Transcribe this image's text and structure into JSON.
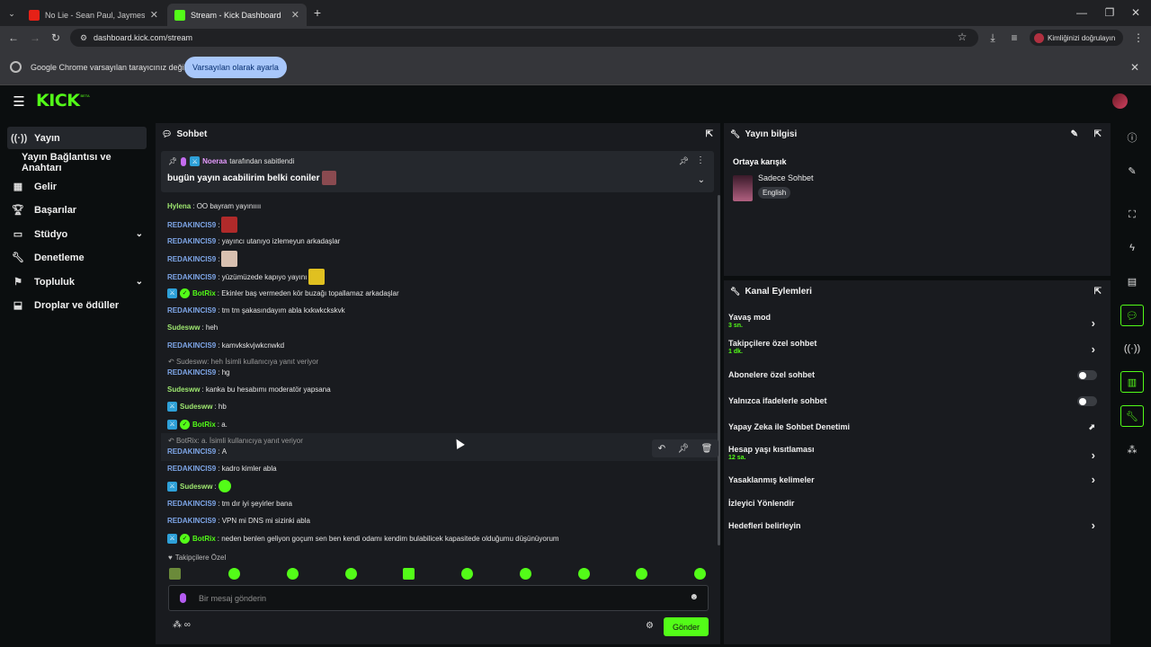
{
  "browser": {
    "tabs": [
      {
        "title": "No Lie - Sean Paul, Jaymes You",
        "active": false
      },
      {
        "title": "Stream - Kick Dashboard",
        "active": true
      }
    ],
    "new_tab_icon": "+",
    "url": "dashboard.kick.com/stream",
    "profile_label": "Kimliğinizi doğrulayın",
    "infobar_text": "Google Chrome varsayılan tarayıcınız değil",
    "infobar_button": "Varsayılan olarak ayarla"
  },
  "app": {
    "logo": "KICK",
    "logo_sup": "BETA"
  },
  "sidebar": {
    "items": [
      {
        "label": "Yayın",
        "icon": "stream-icon"
      },
      {
        "label": "Yayın Bağlantısı ve Anahtarı",
        "icon": ""
      },
      {
        "label": "Gelir",
        "icon": "chart-icon"
      },
      {
        "label": "Başarılar",
        "icon": "trophy-icon"
      },
      {
        "label": "Stüdyo",
        "icon": "studio-icon"
      },
      {
        "label": "Denetleme",
        "icon": "wrench-icon"
      },
      {
        "label": "Topluluk",
        "icon": "community-icon"
      },
      {
        "label": "Droplar ve ödüller",
        "icon": "drops-icon"
      }
    ]
  },
  "chat": {
    "title": "Sohbet",
    "pinned_by_user": "Noeraa",
    "pinned_by_text": "tarafından sabitlendi",
    "pinned_message": "bugün yayın acabilirim belki coniler",
    "messages": [
      {
        "user": "Hylena",
        "text": "OO bayram yayınıııı",
        "color": "lgreen"
      },
      {
        "user": "REDAKINCIS9",
        "text": "",
        "color": "blue"
      },
      {
        "user": "REDAKINCIS9",
        "text": "yayıncı utanıyo izlemeyun arkadaşlar",
        "color": "blue"
      },
      {
        "user": "REDAKINCIS9",
        "text": "",
        "color": "blue"
      },
      {
        "user": "REDAKINCIS9",
        "text": "yüzümüzede kapıyo yayını",
        "color": "blue"
      },
      {
        "user": "BotRix",
        "text": "Ekinler baş vermeden kör buzağı topallamaz arkadaşlar",
        "color": "green"
      },
      {
        "user": "REDAKINCIS9",
        "text": "tm tm şakasındayım abla kxkwkckskvk",
        "color": "blue"
      },
      {
        "user": "Sudesww",
        "text": "heh",
        "color": "lgreen"
      },
      {
        "user": "REDAKINCIS9",
        "text": "kamvkskvjwkcnwkd",
        "color": "blue"
      },
      {
        "user": "REDAKINCIS9",
        "text": "hg",
        "color": "blue"
      },
      {
        "user": "Sudesww",
        "text": "kanka bu hesabımı moderatör yapsana",
        "color": "lgreen"
      },
      {
        "user": "Sudesww",
        "text": "hb",
        "color": "lgreen"
      },
      {
        "user": "BotRix",
        "text": "a.",
        "color": "green"
      },
      {
        "user": "REDAKINCIS9",
        "text": "A",
        "color": "blue"
      },
      {
        "user": "REDAKINCIS9",
        "text": "kadro kimler abla",
        "color": "blue"
      },
      {
        "user": "Sudesww",
        "text": "",
        "color": "lgreen"
      },
      {
        "user": "REDAKINCIS9",
        "text": "tm dır iyi şeyirler bana",
        "color": "blue"
      },
      {
        "user": "REDAKINCIS9",
        "text": "VPN mi DNS mi sizinki abla",
        "color": "blue"
      },
      {
        "user": "BotRix",
        "text": "neden benlen geliyon goçum sen ben kendi odamı kendim bulabilicek kapasitede olduğumu düşünüyorum",
        "color": "green"
      }
    ],
    "replies": [
      {
        "text": "Sudesww: heh İsimli kullanıcıya yanıt veriyor"
      },
      {
        "text": "BotRix: a. İsimli kullanıcıya yanıt veriyor"
      }
    ],
    "followers_only_label": "Takipçilere Özel",
    "input_placeholder": "Bir mesaj gönderin",
    "send_label": "Gönder"
  },
  "stream_info": {
    "title": "Yayın bilgisi",
    "stream_title": "Ortaya karışık",
    "category": "Sadece Sohbet",
    "language": "English"
  },
  "channel_actions": {
    "title": "Kanal Eylemleri",
    "items": [
      {
        "label": "Yavaş mod",
        "sub": "3 sn.",
        "control": "chevron"
      },
      {
        "label": "Takipçilere özel sohbet",
        "sub": "1 dk.",
        "control": "chevron"
      },
      {
        "label": "Abonelere özel sohbet",
        "sub": "",
        "control": "toggle"
      },
      {
        "label": "Yalnızca ifadelerle sohbet",
        "sub": "",
        "control": "toggle"
      },
      {
        "label": "Yapay Zeka ile Sohbet Denetimi",
        "sub": "",
        "control": "external"
      },
      {
        "label": "Hesap yaşı kısıtlaması",
        "sub": "12 sa.",
        "control": "chevron"
      },
      {
        "label": "Yasaklanmış kelimeler",
        "sub": "",
        "control": "chevron"
      },
      {
        "label": "İzleyici Yönlendir",
        "sub": "",
        "control": "none"
      },
      {
        "label": "Hedefleri belirleyin",
        "sub": "",
        "control": "chevron"
      }
    ]
  },
  "colors": {
    "kick_green": "#53fc18",
    "panel_bg": "#191b1f",
    "page_bg": "#0b0e0f"
  }
}
